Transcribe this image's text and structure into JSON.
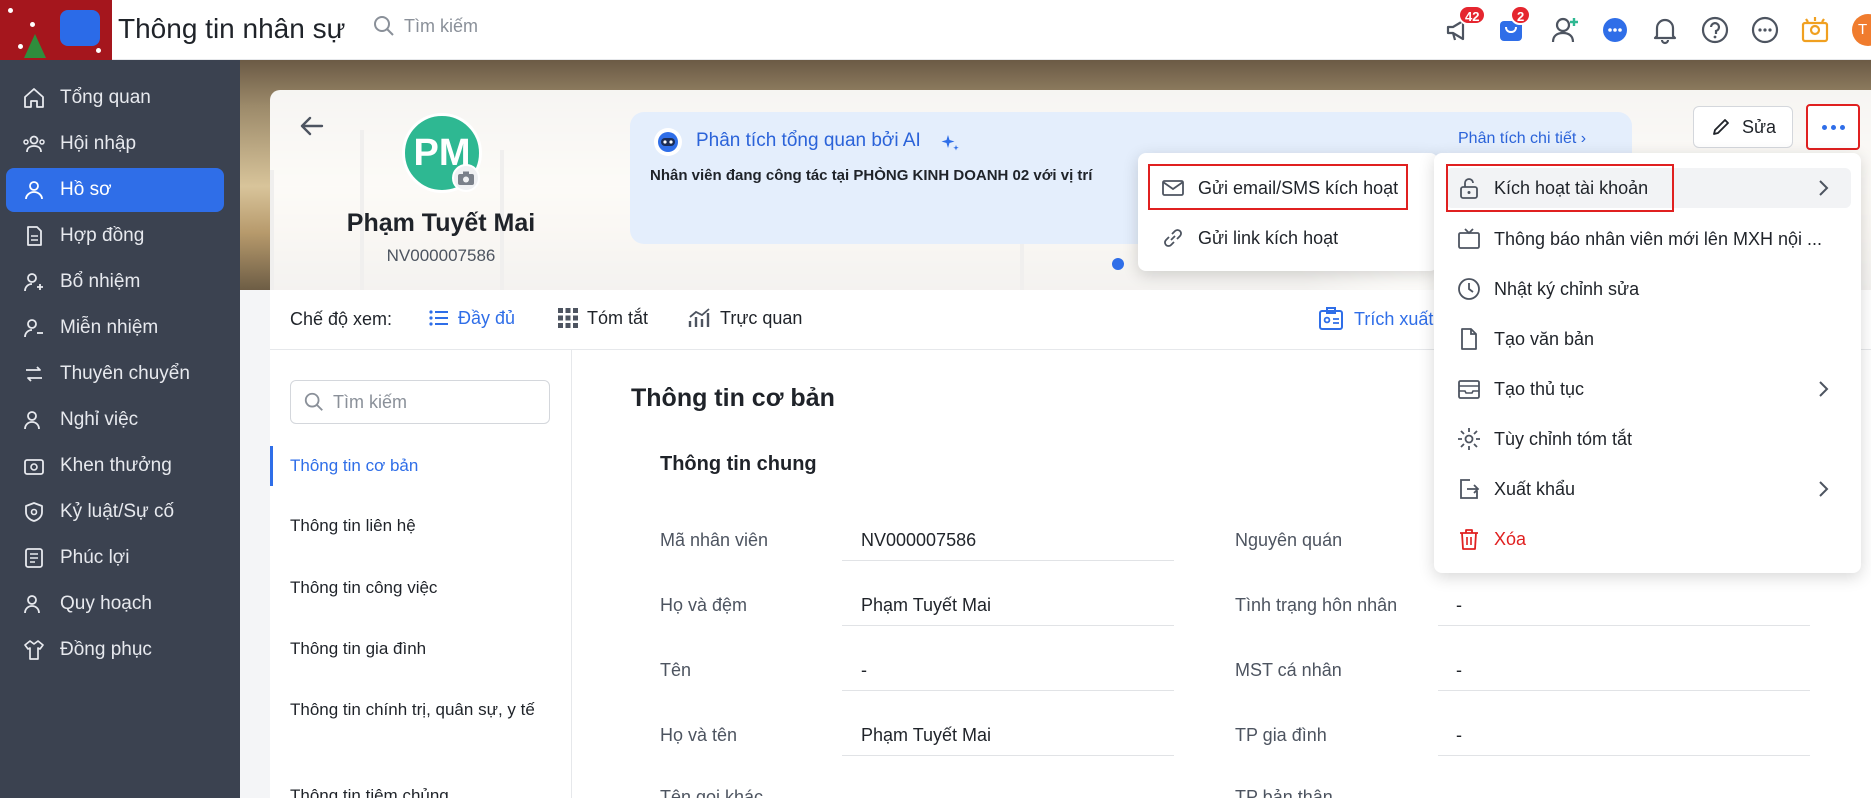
{
  "header": {
    "app_title": "Thông tin nhân sự",
    "search_placeholder": "Tìm kiếm",
    "announcement_badge": "42",
    "store_badge": "2",
    "user_initial": "T"
  },
  "sidebar": {
    "items": [
      {
        "label": "Tổng quan",
        "icon": "home-icon"
      },
      {
        "label": "Hội nhập",
        "icon": "users-icon"
      },
      {
        "label": "Hồ sơ",
        "icon": "user-icon"
      },
      {
        "label": "Hợp đồng",
        "icon": "document-icon"
      },
      {
        "label": "Bổ nhiệm",
        "icon": "user-plus-icon"
      },
      {
        "label": "Miễn nhiệm",
        "icon": "user-minus-icon"
      },
      {
        "label": "Thuyên chuyển",
        "icon": "transfer-icon"
      },
      {
        "label": "Nghỉ việc",
        "icon": "user-leave-icon"
      },
      {
        "label": "Khen thưởng",
        "icon": "reward-icon"
      },
      {
        "label": "Kỷ luật/Sự cố",
        "icon": "shield-icon"
      },
      {
        "label": "Phúc lợi",
        "icon": "benefit-icon"
      },
      {
        "label": "Quy hoạch",
        "icon": "planning-icon"
      },
      {
        "label": "Đồng phục",
        "icon": "shirt-icon"
      }
    ],
    "active": "Hồ sơ"
  },
  "profile": {
    "initials": "PM",
    "name": "Phạm Tuyết Mai",
    "code": "NV000007586",
    "edit_label": "Sửa"
  },
  "ai_panel": {
    "title": "Phân tích tổng quan bởi AI",
    "detail_link": "Phân tích chi tiết",
    "summary": "Nhân viên đang công tác tại PHÒNG KINH DOANH 02 với vị trí"
  },
  "view_mode": {
    "label": "Chế độ xem:",
    "options": [
      "Đầy đủ",
      "Tóm tắt",
      "Trực quan"
    ],
    "selected": "Đầy đủ",
    "extract_label": "Trích xuất"
  },
  "left_nav": {
    "search_placeholder": "Tìm kiếm",
    "items": [
      "Thông tin cơ bản",
      "Thông tin liên hệ",
      "Thông tin công việc",
      "Thông tin gia đình",
      "Thông tin chính trị, quân sự, y tế",
      "Thông tin tiêm chủng"
    ],
    "active": "Thông tin cơ bản"
  },
  "main": {
    "section_title": "Thông tin cơ bản",
    "subsection_title": "Thông tin chung",
    "left_fields": [
      {
        "label": "Mã nhân viên",
        "value": "NV000007586"
      },
      {
        "label": "Họ và đệm",
        "value": "Phạm Tuyết Mai"
      },
      {
        "label": "Tên",
        "value": "-"
      },
      {
        "label": "Họ và tên",
        "value": "Phạm Tuyết Mai"
      },
      {
        "label": "Tên gọi khác",
        "value": ""
      }
    ],
    "right_fields": [
      {
        "label": "Nguyên quán",
        "value": ""
      },
      {
        "label": "Tình trạng hôn nhân",
        "value": "-"
      },
      {
        "label": "MST cá nhân",
        "value": "-"
      },
      {
        "label": "TP gia đình",
        "value": "-"
      },
      {
        "label": "TP bản thân",
        "value": ""
      }
    ]
  },
  "activation_submenu": {
    "items": [
      "Gửi email/SMS kích hoạt",
      "Gửi link kích hoạt"
    ]
  },
  "more_menu": {
    "items": [
      {
        "label": "Kích hoạt tài khoản",
        "icon": "unlock-icon",
        "has_submenu": true
      },
      {
        "label": "Thông báo nhân viên mới lên MXH nội ...",
        "icon": "tv-icon",
        "has_submenu": false
      },
      {
        "label": "Nhật ký chỉnh sửa",
        "icon": "clock-icon",
        "has_submenu": false
      },
      {
        "label": "Tạo văn bản",
        "icon": "file-icon",
        "has_submenu": false
      },
      {
        "label": "Tạo thủ tục",
        "icon": "inbox-icon",
        "has_submenu": true
      },
      {
        "label": "Tùy chỉnh tóm tắt",
        "icon": "gear-icon",
        "has_submenu": false
      },
      {
        "label": "Xuất khẩu",
        "icon": "export-icon",
        "has_submenu": true
      },
      {
        "label": "Xóa",
        "icon": "trash-icon",
        "has_submenu": false
      }
    ]
  },
  "colors": {
    "accent": "#2f6ee8",
    "sidebar_bg": "#3b4250",
    "highlight_box": "#e02020",
    "danger": "#e02020"
  }
}
